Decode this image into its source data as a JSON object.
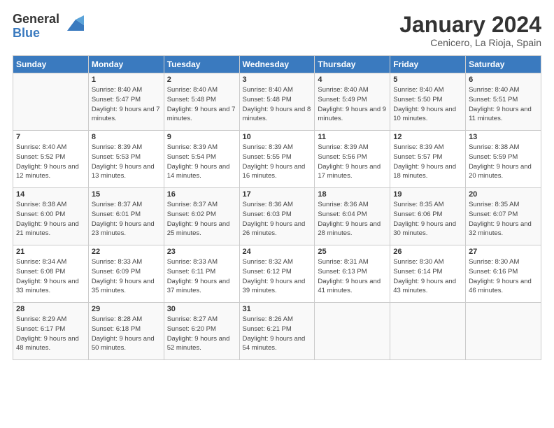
{
  "header": {
    "logo_general": "General",
    "logo_blue": "Blue",
    "month_title": "January 2024",
    "location": "Cenicero, La Rioja, Spain"
  },
  "days_of_week": [
    "Sunday",
    "Monday",
    "Tuesday",
    "Wednesday",
    "Thursday",
    "Friday",
    "Saturday"
  ],
  "weeks": [
    [
      {
        "day": "",
        "sunrise": "",
        "sunset": "",
        "daylight": ""
      },
      {
        "day": "1",
        "sunrise": "Sunrise: 8:40 AM",
        "sunset": "Sunset: 5:47 PM",
        "daylight": "Daylight: 9 hours and 7 minutes."
      },
      {
        "day": "2",
        "sunrise": "Sunrise: 8:40 AM",
        "sunset": "Sunset: 5:48 PM",
        "daylight": "Daylight: 9 hours and 7 minutes."
      },
      {
        "day": "3",
        "sunrise": "Sunrise: 8:40 AM",
        "sunset": "Sunset: 5:48 PM",
        "daylight": "Daylight: 9 hours and 8 minutes."
      },
      {
        "day": "4",
        "sunrise": "Sunrise: 8:40 AM",
        "sunset": "Sunset: 5:49 PM",
        "daylight": "Daylight: 9 hours and 9 minutes."
      },
      {
        "day": "5",
        "sunrise": "Sunrise: 8:40 AM",
        "sunset": "Sunset: 5:50 PM",
        "daylight": "Daylight: 9 hours and 10 minutes."
      },
      {
        "day": "6",
        "sunrise": "Sunrise: 8:40 AM",
        "sunset": "Sunset: 5:51 PM",
        "daylight": "Daylight: 9 hours and 11 minutes."
      }
    ],
    [
      {
        "day": "7",
        "sunrise": "Sunrise: 8:40 AM",
        "sunset": "Sunset: 5:52 PM",
        "daylight": "Daylight: 9 hours and 12 minutes."
      },
      {
        "day": "8",
        "sunrise": "Sunrise: 8:39 AM",
        "sunset": "Sunset: 5:53 PM",
        "daylight": "Daylight: 9 hours and 13 minutes."
      },
      {
        "day": "9",
        "sunrise": "Sunrise: 8:39 AM",
        "sunset": "Sunset: 5:54 PM",
        "daylight": "Daylight: 9 hours and 14 minutes."
      },
      {
        "day": "10",
        "sunrise": "Sunrise: 8:39 AM",
        "sunset": "Sunset: 5:55 PM",
        "daylight": "Daylight: 9 hours and 16 minutes."
      },
      {
        "day": "11",
        "sunrise": "Sunrise: 8:39 AM",
        "sunset": "Sunset: 5:56 PM",
        "daylight": "Daylight: 9 hours and 17 minutes."
      },
      {
        "day": "12",
        "sunrise": "Sunrise: 8:39 AM",
        "sunset": "Sunset: 5:57 PM",
        "daylight": "Daylight: 9 hours and 18 minutes."
      },
      {
        "day": "13",
        "sunrise": "Sunrise: 8:38 AM",
        "sunset": "Sunset: 5:59 PM",
        "daylight": "Daylight: 9 hours and 20 minutes."
      }
    ],
    [
      {
        "day": "14",
        "sunrise": "Sunrise: 8:38 AM",
        "sunset": "Sunset: 6:00 PM",
        "daylight": "Daylight: 9 hours and 21 minutes."
      },
      {
        "day": "15",
        "sunrise": "Sunrise: 8:37 AM",
        "sunset": "Sunset: 6:01 PM",
        "daylight": "Daylight: 9 hours and 23 minutes."
      },
      {
        "day": "16",
        "sunrise": "Sunrise: 8:37 AM",
        "sunset": "Sunset: 6:02 PM",
        "daylight": "Daylight: 9 hours and 25 minutes."
      },
      {
        "day": "17",
        "sunrise": "Sunrise: 8:36 AM",
        "sunset": "Sunset: 6:03 PM",
        "daylight": "Daylight: 9 hours and 26 minutes."
      },
      {
        "day": "18",
        "sunrise": "Sunrise: 8:36 AM",
        "sunset": "Sunset: 6:04 PM",
        "daylight": "Daylight: 9 hours and 28 minutes."
      },
      {
        "day": "19",
        "sunrise": "Sunrise: 8:35 AM",
        "sunset": "Sunset: 6:06 PM",
        "daylight": "Daylight: 9 hours and 30 minutes."
      },
      {
        "day": "20",
        "sunrise": "Sunrise: 8:35 AM",
        "sunset": "Sunset: 6:07 PM",
        "daylight": "Daylight: 9 hours and 32 minutes."
      }
    ],
    [
      {
        "day": "21",
        "sunrise": "Sunrise: 8:34 AM",
        "sunset": "Sunset: 6:08 PM",
        "daylight": "Daylight: 9 hours and 33 minutes."
      },
      {
        "day": "22",
        "sunrise": "Sunrise: 8:33 AM",
        "sunset": "Sunset: 6:09 PM",
        "daylight": "Daylight: 9 hours and 35 minutes."
      },
      {
        "day": "23",
        "sunrise": "Sunrise: 8:33 AM",
        "sunset": "Sunset: 6:11 PM",
        "daylight": "Daylight: 9 hours and 37 minutes."
      },
      {
        "day": "24",
        "sunrise": "Sunrise: 8:32 AM",
        "sunset": "Sunset: 6:12 PM",
        "daylight": "Daylight: 9 hours and 39 minutes."
      },
      {
        "day": "25",
        "sunrise": "Sunrise: 8:31 AM",
        "sunset": "Sunset: 6:13 PM",
        "daylight": "Daylight: 9 hours and 41 minutes."
      },
      {
        "day": "26",
        "sunrise": "Sunrise: 8:30 AM",
        "sunset": "Sunset: 6:14 PM",
        "daylight": "Daylight: 9 hours and 43 minutes."
      },
      {
        "day": "27",
        "sunrise": "Sunrise: 8:30 AM",
        "sunset": "Sunset: 6:16 PM",
        "daylight": "Daylight: 9 hours and 46 minutes."
      }
    ],
    [
      {
        "day": "28",
        "sunrise": "Sunrise: 8:29 AM",
        "sunset": "Sunset: 6:17 PM",
        "daylight": "Daylight: 9 hours and 48 minutes."
      },
      {
        "day": "29",
        "sunrise": "Sunrise: 8:28 AM",
        "sunset": "Sunset: 6:18 PM",
        "daylight": "Daylight: 9 hours and 50 minutes."
      },
      {
        "day": "30",
        "sunrise": "Sunrise: 8:27 AM",
        "sunset": "Sunset: 6:20 PM",
        "daylight": "Daylight: 9 hours and 52 minutes."
      },
      {
        "day": "31",
        "sunrise": "Sunrise: 8:26 AM",
        "sunset": "Sunset: 6:21 PM",
        "daylight": "Daylight: 9 hours and 54 minutes."
      },
      {
        "day": "",
        "sunrise": "",
        "sunset": "",
        "daylight": ""
      },
      {
        "day": "",
        "sunrise": "",
        "sunset": "",
        "daylight": ""
      },
      {
        "day": "",
        "sunrise": "",
        "sunset": "",
        "daylight": ""
      }
    ]
  ]
}
